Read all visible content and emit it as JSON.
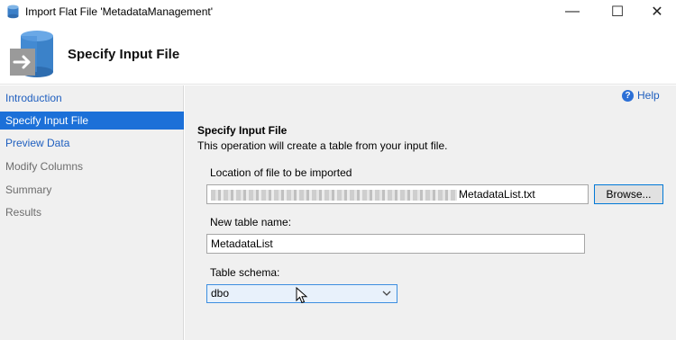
{
  "window": {
    "title": "Import Flat File 'MetadataManagement'",
    "minimize_glyph": "—",
    "maximize_glyph": "☐",
    "close_glyph": "✕",
    "icon": "database-window-icon"
  },
  "header": {
    "title": "Specify Input File",
    "icon": "database-import-arrow-icon"
  },
  "sidebar": {
    "items": [
      {
        "label": "Introduction",
        "state": "link"
      },
      {
        "label": "Specify Input File",
        "state": "active"
      },
      {
        "label": "Preview Data",
        "state": "link"
      },
      {
        "label": "Modify Columns",
        "state": "disabled"
      },
      {
        "label": "Summary",
        "state": "disabled"
      },
      {
        "label": "Results",
        "state": "disabled"
      }
    ]
  },
  "help": {
    "label": "Help",
    "icon": "help-circle-icon"
  },
  "section": {
    "title": "Specify Input File",
    "description": "This operation will create a table from your input file."
  },
  "file": {
    "label": "Location of file to be imported",
    "value_visible": "MetadataList.txt",
    "browse_label": "Browse..."
  },
  "table_name": {
    "label": "New table name:",
    "value": "MetadataList"
  },
  "schema": {
    "label": "Table schema:",
    "selected": "dbo"
  },
  "colors": {
    "accent": "#1c70d8",
    "link": "#1f5fbf",
    "panel_bg": "#f0f0f0"
  }
}
